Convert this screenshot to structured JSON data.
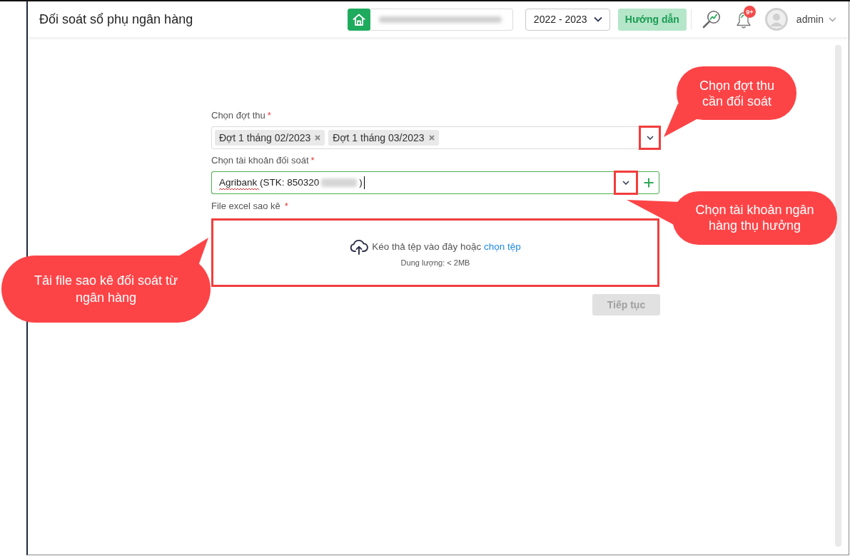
{
  "header": {
    "title": "Đối soát sổ phụ ngân hàng",
    "year_select": {
      "value": "2022 - 2023"
    },
    "guide_button": "Hướng dẫn",
    "notifications": {
      "badge": "9+"
    },
    "user": {
      "name": "admin"
    }
  },
  "form": {
    "fields": [
      {
        "kind": "multiselect",
        "label": "Chọn đợt thu",
        "required_mark": "*",
        "tags": [
          "Đợt 1 tháng 02/2023",
          "Đợt 1 tháng 03/2023"
        ],
        "highlighted": true
      },
      {
        "kind": "select",
        "label": "Chọn tài khoản đối soát",
        "required_mark": "*",
        "value": "Agribank (STK: 850320",
        "value_end": ")",
        "spellcheck_marked": true,
        "focused": true,
        "highlighted": true
      },
      {
        "kind": "upload",
        "label": "File excel sao kê",
        "required_mark": "*",
        "prompt": "Kéo thả tệp vào đây hoặc",
        "link": "chọn tệp",
        "hint": "Dung lượng: < 2MB",
        "highlighted": true
      }
    ],
    "submit": {
      "label": "Tiếp tục",
      "disabled": true
    }
  },
  "callouts": [
    {
      "text": "Chọn đợt thu cần đối soát"
    },
    {
      "text": "Chọn tài khoản ngân hàng thụ hưởng"
    },
    {
      "text": "Tải file sao kê đối soát từ ngân hàng"
    }
  ]
}
